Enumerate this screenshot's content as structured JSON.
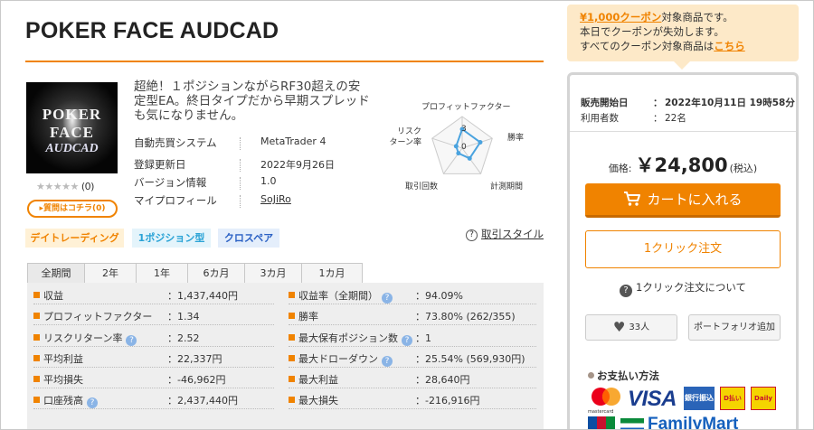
{
  "product": {
    "title": "POKER FACE AUDCAD",
    "thumbnail": {
      "line1": "POKER FACE",
      "line2": "AUDCAD"
    },
    "rating": {
      "stars": "★★★★★",
      "stars_filled": 0,
      "count": "(0)"
    },
    "qa_label": "▸質問はコチラ(0)",
    "catch_copy": "超絶！１ポジションながらRF30超えの安定型EA。終日タイプだから早期スプレッドも気になりません。",
    "info": [
      {
        "label": "自動売買システム",
        "value": "MetaTrader 4"
      },
      {
        "label": "登録更新日",
        "value": "2022年9月26日"
      },
      {
        "label": "バージョン情報",
        "value": "1.0"
      },
      {
        "label": "マイプロフィール",
        "value": "SoJiRo"
      }
    ],
    "tags": [
      "デイトレーディング",
      "1ポジション型",
      "クロスペア"
    ],
    "help_style": {
      "icon": "?",
      "label": "取引スタイル"
    }
  },
  "radar": {
    "axes": [
      "プロフィットファクター",
      "勝率",
      "計測期間",
      "取引回数",
      "リスク\nターン率"
    ],
    "scale_labels": [
      "3",
      "0"
    ],
    "values": [
      3,
      3,
      2,
      1,
      1
    ],
    "max": 5,
    "color": "#4aa3df"
  },
  "tabs": [
    "全期間",
    "2年",
    "1年",
    "6カ月",
    "3カ月",
    "1カ月"
  ],
  "stats_left": [
    {
      "label": "収益",
      "value": "：1,437,440円",
      "help": false
    },
    {
      "label": "プロフィットファクター",
      "value": "：1.34",
      "help": false
    },
    {
      "label": "リスクリターン率",
      "value": "：2.52",
      "help": true
    },
    {
      "label": "平均利益",
      "value": "：22,337円",
      "help": false
    },
    {
      "label": "平均損失",
      "value": "：-46,962円",
      "help": false
    },
    {
      "label": "口座残高",
      "value": "：2,437,440円",
      "help": true
    }
  ],
  "stats_right": [
    {
      "label": "収益率（全期間）",
      "value": "：94.09%",
      "help": true
    },
    {
      "label": "勝率",
      "value": "：73.80% (262/355)",
      "help": false
    },
    {
      "label": "最大保有ポジション数",
      "value": "：1",
      "help": true
    },
    {
      "label": "最大ドローダウン",
      "value": "：25.54% (569,930円)",
      "help": true
    },
    {
      "label": "最大利益",
      "value": "：28,640円",
      "help": false
    },
    {
      "label": "最大損失",
      "value": "：-216,916円",
      "help": false
    }
  ],
  "coupon": {
    "highlight": "¥1,000クーポン",
    "line1_rest": "対象商品です。",
    "line2": "本日でクーポンが失効します。",
    "line3_pre": "すべてのクーポン対象商品は",
    "line3_link": "こちら"
  },
  "sale": {
    "start_label": "販売開始日",
    "start_value": "2022年10月11日 19時58分",
    "users_label": "利用者数",
    "users_value": "22名",
    "colon": "："
  },
  "price": {
    "label": "価格:",
    "value": "￥24,800",
    "tax": "(税込)"
  },
  "buttons": {
    "cart": "カートに入れる",
    "oneclick": "1クリック注文",
    "oneclick_about": "1クリック注文について",
    "like_count": "33人",
    "portfolio": "ポートフォリオ追加"
  },
  "payment": {
    "title": "お支払い方法",
    "mastercard": "mastercard",
    "visa": "VISA",
    "bank": "銀行振込",
    "d1": "D払い",
    "d2": "Daily",
    "familymart": "FamilyMart"
  },
  "colors": {
    "accent": "#f08300",
    "radar": "#4aa3df"
  }
}
